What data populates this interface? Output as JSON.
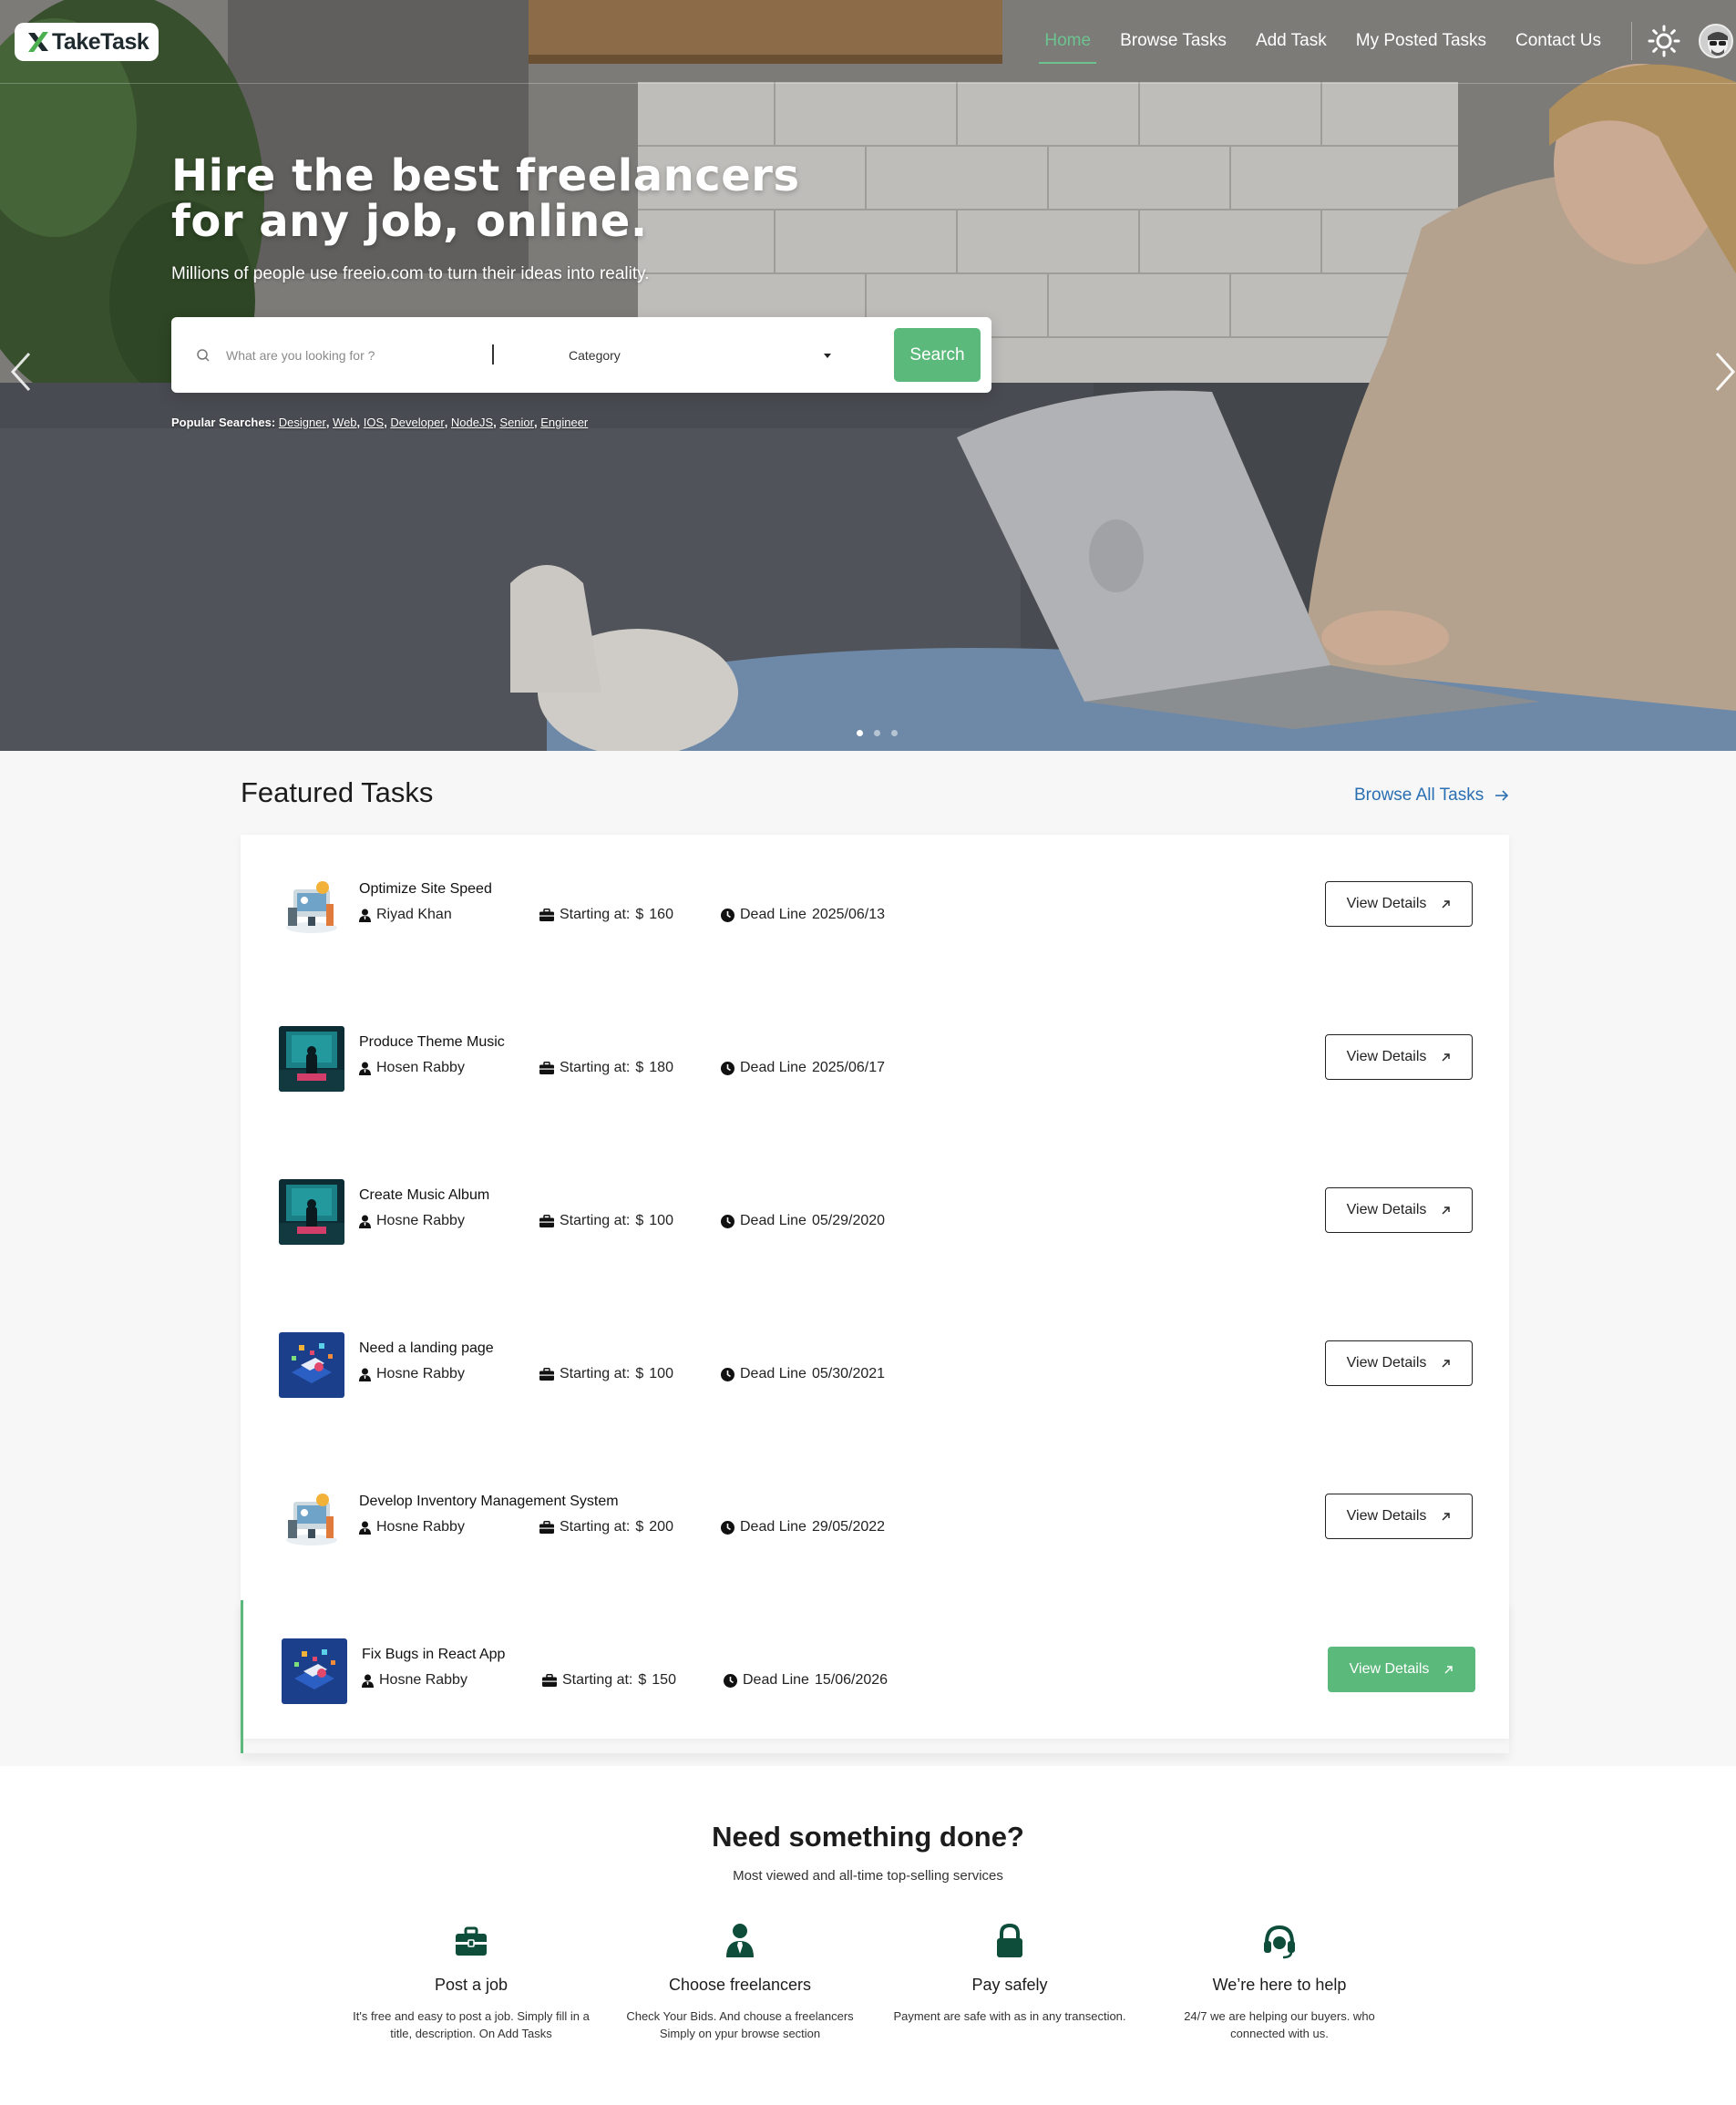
{
  "brand": {
    "name": "TakeTask",
    "accent": "#5bb97b",
    "accent_dark": "#0e4d3a"
  },
  "nav": {
    "items": [
      {
        "label": "Home",
        "active": true
      },
      {
        "label": "Browse Tasks",
        "active": false
      },
      {
        "label": "Add Task",
        "active": false
      },
      {
        "label": "My Posted Tasks",
        "active": false
      },
      {
        "label": "Contact Us",
        "active": false
      }
    ],
    "theme_icon": "sun-icon",
    "avatar_icon": "user-avatar"
  },
  "hero": {
    "title": "Hire the best freelancers for any job, online.",
    "subtitle": "Millions of people use freeio.com to turn their ideas into reality.",
    "search": {
      "placeholder": "What are you looking for ?",
      "category_label": "Category",
      "button_label": "Search"
    },
    "popular_label": "Popular Searches:",
    "popular_tags": [
      "Designer",
      "Web",
      "IOS",
      "Developer",
      "NodeJS",
      "Senior",
      "Engineer"
    ],
    "slides": 3,
    "active_slide": 1
  },
  "featured": {
    "title": "Featured Tasks",
    "browse_all_label": "Browse All Tasks",
    "starting_label": "Starting at:",
    "currency": "$",
    "deadline_label": "Dead Line",
    "view_label": "View Details",
    "tasks": [
      {
        "title": "Optimize Site Speed",
        "author": "Riyad Khan",
        "price": "160",
        "deadline": "2025/06/13",
        "thumb": "illustration",
        "highlight": false
      },
      {
        "title": "Produce Theme Music",
        "author": "Hosen Rabby",
        "price": "180",
        "deadline": "2025/06/17",
        "thumb": "music",
        "highlight": false
      },
      {
        "title": "Create Music Album",
        "author": "Hosne Rabby",
        "price": "100",
        "deadline": "05/29/2020",
        "thumb": "music",
        "highlight": false
      },
      {
        "title": "Need a landing page",
        "author": "Hosne Rabby",
        "price": "100",
        "deadline": "05/30/2021",
        "thumb": "isometric",
        "highlight": false
      },
      {
        "title": "Develop Inventory Management System",
        "author": "Hosne Rabby",
        "price": "200",
        "deadline": "29/05/2022",
        "thumb": "illustration",
        "highlight": false
      },
      {
        "title": "Fix Bugs in React App",
        "author": "Hosne Rabby",
        "price": "150",
        "deadline": "15/06/2026",
        "thumb": "isometric",
        "highlight": true
      }
    ]
  },
  "need": {
    "title": "Need something done?",
    "subtitle": "Most viewed and all-time top-selling services",
    "features": [
      {
        "icon": "briefcase-icon",
        "title": "Post a job",
        "desc": "It's free and easy to post a job. Simply fill in a title, description. On Add Tasks"
      },
      {
        "icon": "user-tie-icon",
        "title": "Choose freelancers",
        "desc": "Check Your Bids. And chouse a freelancers Simply on ypur browse section"
      },
      {
        "icon": "lock-icon",
        "title": "Pay safely",
        "desc": "Payment are safe with as in any transection."
      },
      {
        "icon": "headset-icon",
        "title": "We’re here to help",
        "desc": "24/7 we are helping our buyers. who connected with us."
      }
    ]
  }
}
